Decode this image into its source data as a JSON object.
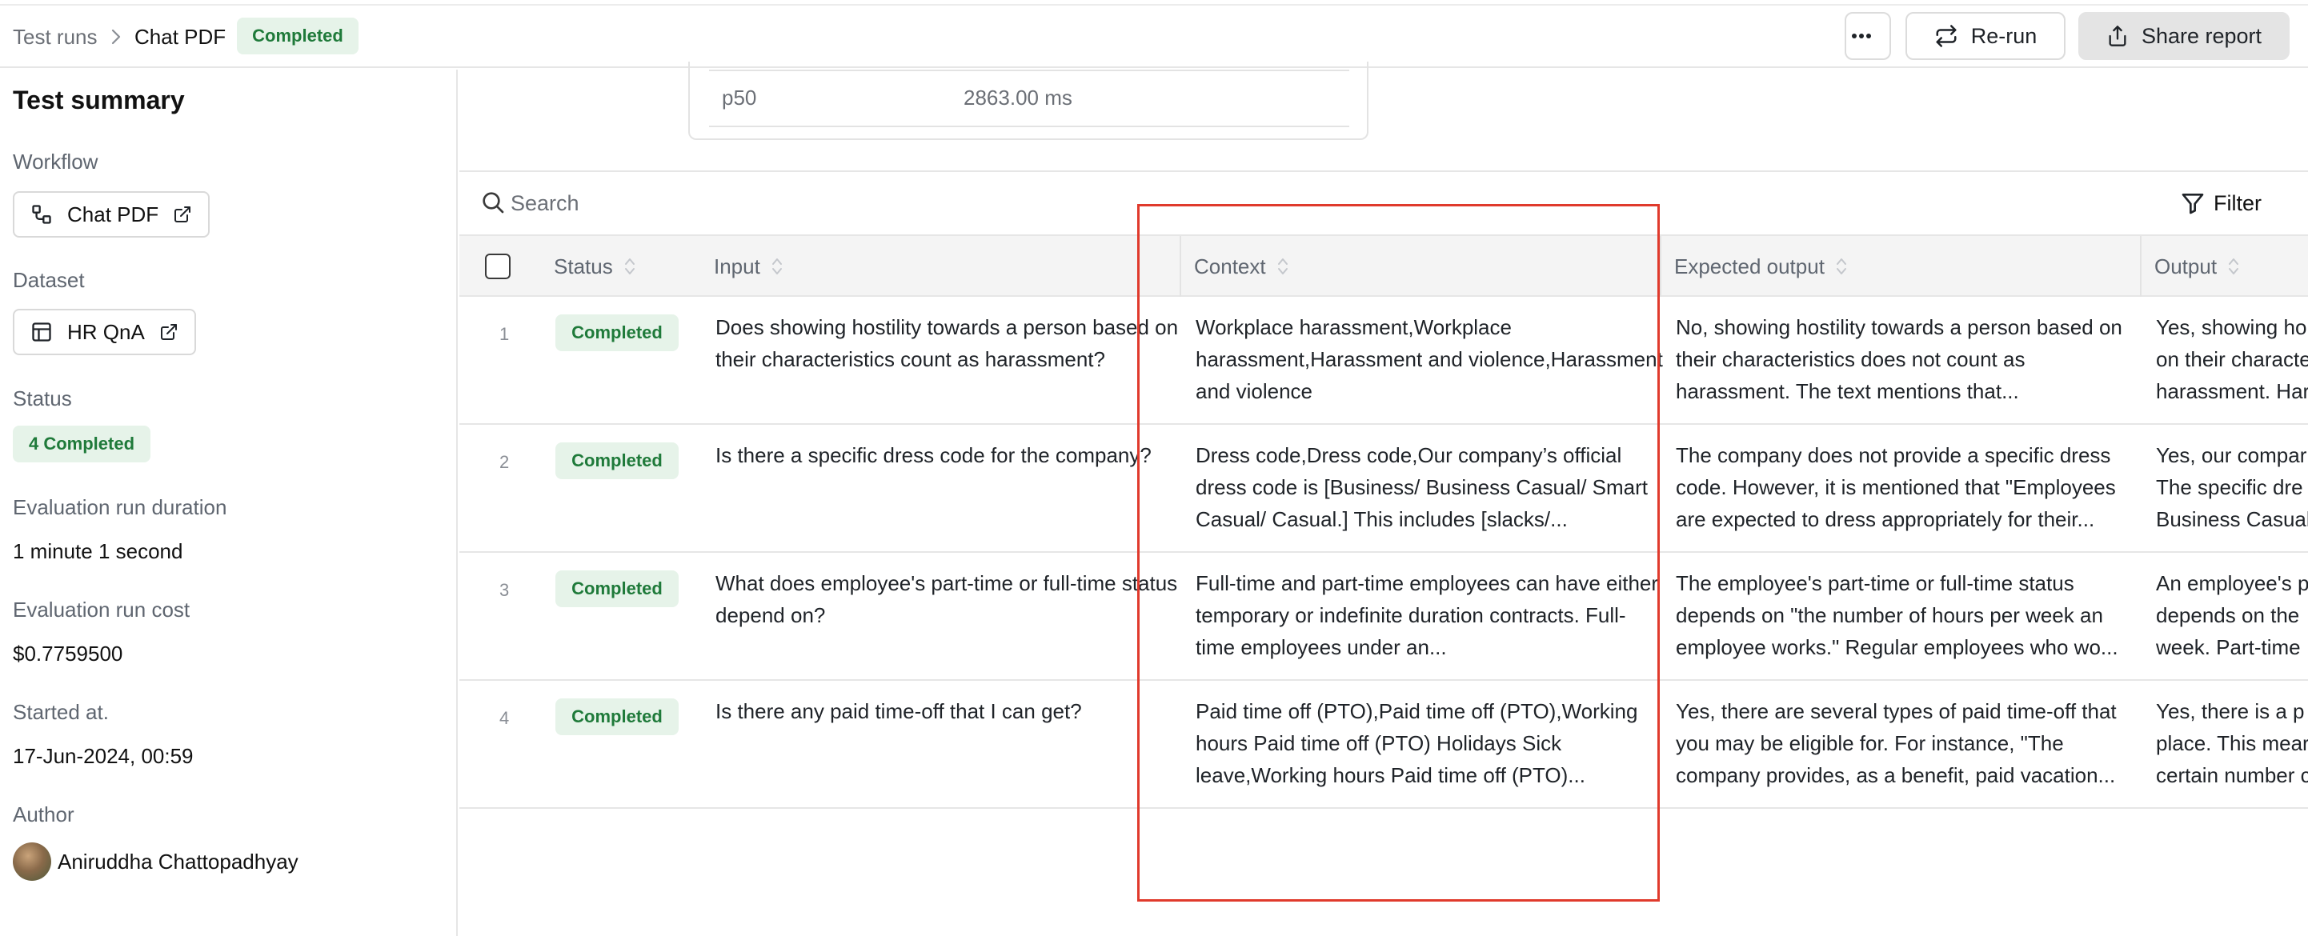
{
  "breadcrumb": {
    "root": "Test runs",
    "separator": ">",
    "current": "Chat PDF"
  },
  "top_status_badge": "Completed",
  "actions": {
    "more_icon": "ellipsis-icon",
    "rerun_label": "Re-run",
    "share_label": "Share report"
  },
  "sidebar": {
    "title": "Test summary",
    "workflow_label": "Workflow",
    "workflow_value": "Chat PDF",
    "dataset_label": "Dataset",
    "dataset_value": "HR QnA",
    "status_label": "Status",
    "status_value": "4 Completed",
    "duration_label": "Evaluation run duration",
    "duration_value": "1 minute 1 second",
    "cost_label": "Evaluation run cost",
    "cost_value": "$0.7759500",
    "started_label": "Started at.",
    "started_value": "17-Jun-2024, 00:59",
    "author_label": "Author",
    "author_name": "Aniruddha Chattopadhyay"
  },
  "stats": {
    "key": "p50",
    "value": "2863.00 ms"
  },
  "search": {
    "placeholder": "Search"
  },
  "filter_label": "Filter",
  "columns": {
    "status": "Status",
    "input": "Input",
    "context": "Context",
    "expected": "Expected output",
    "output": "Output"
  },
  "rows": [
    {
      "num": "1",
      "status": "Completed",
      "input": "Does showing hostility towards a person based on their characteristics count as harassment?",
      "context": "Workplace harassment,Workplace harassment,Harassment and violence,Harassment and violence",
      "expected": "No, showing hostility towards a person based on their characteristics does not count as harassment. The text mentions that...",
      "output_lines": [
        "Yes, showing ho",
        "on their characte",
        "harassment. Har"
      ]
    },
    {
      "num": "2",
      "status": "Completed",
      "input": "Is there a specific dress code for the company?",
      "context": "Dress code,Dress code,Our company’s official dress code is [Business/ Business Casual/ Smart Casual/ Casual.] This includes [slacks/...",
      "expected": "The company does not provide a specific dress code. However, it is mentioned that \"Employees are expected to dress appropriately for their...",
      "output_lines": [
        "Yes, our compar",
        "The specific dre",
        "Business Casual"
      ]
    },
    {
      "num": "3",
      "status": "Completed",
      "input": "What does employee's part-time or full-time status depend on?",
      "context": "Full-time and part-time employees can have either temporary or indefinite duration contracts. Full-time employees under an...",
      "expected": "The employee's part-time or full-time status depends on \"the number of hours per week an employee works.\" Regular employees who wo...",
      "output_lines": [
        "An employee's p",
        "depends on the",
        "week. Part-time"
      ]
    },
    {
      "num": "4",
      "status": "Completed",
      "input": "Is there any paid time-off that I can get?",
      "context": "Paid time off (PTO),Paid time off (PTO),Working hours Paid time off (PTO) Holidays Sick leave,Working hours Paid time off (PTO)...",
      "expected": "Yes, there are several types of paid time-off that you may be eligible for. For instance, \"The company provides, as a benefit, paid vacation...",
      "output_lines": [
        "Yes, there is a p",
        "place. This mear",
        "certain number c"
      ]
    }
  ],
  "colors": {
    "badge_bg": "#e6f3e9",
    "badge_text": "#1f7a3a",
    "highlight": "#e03a2c"
  }
}
